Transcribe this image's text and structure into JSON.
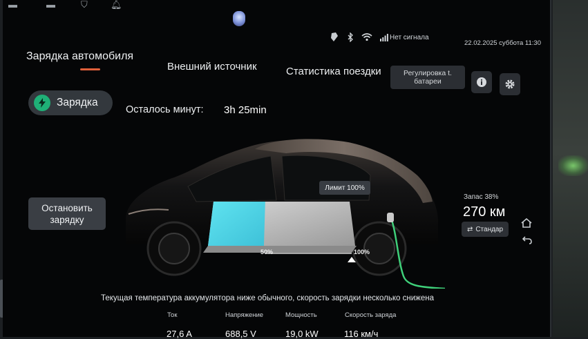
{
  "tabs": [
    {
      "label": "Зарядка автомобиля",
      "active": true
    },
    {
      "label": "Внешний источник",
      "active": false
    },
    {
      "label": "Статистика поездки",
      "active": false
    }
  ],
  "header": {
    "battery_regulation_label": "Регулировка t. батареи",
    "info_icon": "info-icon",
    "settings_icon": "gear-icon"
  },
  "status": {
    "network_text": "Нет сигнала",
    "datetime": "22.02.2025 суббота 11:30",
    "icons": [
      "wireless-charge-icon",
      "bluetooth-icon",
      "wifi-icon",
      "signal-icon"
    ]
  },
  "charging": {
    "status_label": "Зарядка",
    "remaining_label": "Осталось минут:",
    "remaining_value": "3h 25min",
    "stop_button_label": "Остановить зарядку",
    "limit_label": "Лимит 100%",
    "scale_min_label": "50%",
    "scale_max_label": "100%",
    "battery_fill_level": 0.38,
    "charge_limit": 1.0
  },
  "range": {
    "caption": "Запас 38%",
    "value": "270 км",
    "mode_label": "Стандар"
  },
  "notice": "Текущая температура аккумулятора ниже обычного, скорость зарядки несколько снижена",
  "metrics": [
    {
      "label": "Ток",
      "value": "27,6 A"
    },
    {
      "label": "Напряжение",
      "value": "688,5 V"
    },
    {
      "label": "Мощность",
      "value": "19,0 kW"
    },
    {
      "label": "Скорость заряда",
      "value": "116 км/ч"
    }
  ],
  "colors": {
    "accent": "#e0603a",
    "charging_green": "#1fb077",
    "battery_fill": "#4fd6e8",
    "cable_green": "#3fd07a"
  }
}
